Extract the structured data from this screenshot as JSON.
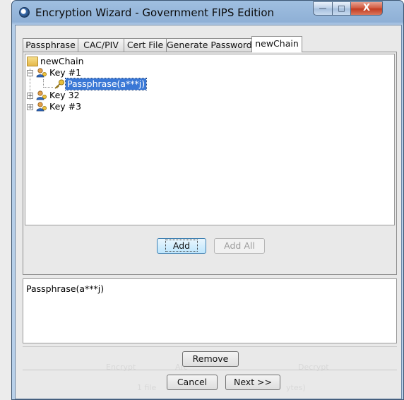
{
  "window": {
    "title": "Encryption Wizard - Government FIPS Edition",
    "controls": {
      "minimize": "—",
      "maximize": "□",
      "close": "X"
    }
  },
  "tabs": [
    {
      "label": "Passphrase"
    },
    {
      "label": "CAC/PIV"
    },
    {
      "label": "Cert File"
    },
    {
      "label": "Generate Password"
    },
    {
      "label": "newChain",
      "active": true
    }
  ],
  "tree": {
    "root": {
      "label": "newChain",
      "icon": "folder-icon"
    },
    "keys": [
      {
        "label": "Key #1",
        "expanded": true,
        "icon": "key-user-icon",
        "children": [
          {
            "label": "Passphrase(a***j)",
            "icon": "passphrase-key-icon",
            "selected": true
          }
        ]
      },
      {
        "label": "Key 32",
        "expanded": false,
        "icon": "key-user-icon"
      },
      {
        "label": "Key #3",
        "expanded": false,
        "icon": "key-user-icon"
      }
    ]
  },
  "buttons": {
    "add": "Add",
    "add_all": "Add All",
    "remove": "Remove",
    "cancel": "Cancel",
    "next": "Next >>"
  },
  "detail": {
    "text": "Passphrase(a***j)"
  },
  "background_faded": {
    "encrypt": "Encrypt",
    "archive": "Arc",
    "decrypt": "Decrypt",
    "file_count": "1 file",
    "bytes": "ytes)"
  },
  "colors": {
    "selection": "#3a78d6",
    "title_gradient_top": "#9fbfe0",
    "close_button": "#c23a1f",
    "client_bg": "#e9e9e9"
  }
}
